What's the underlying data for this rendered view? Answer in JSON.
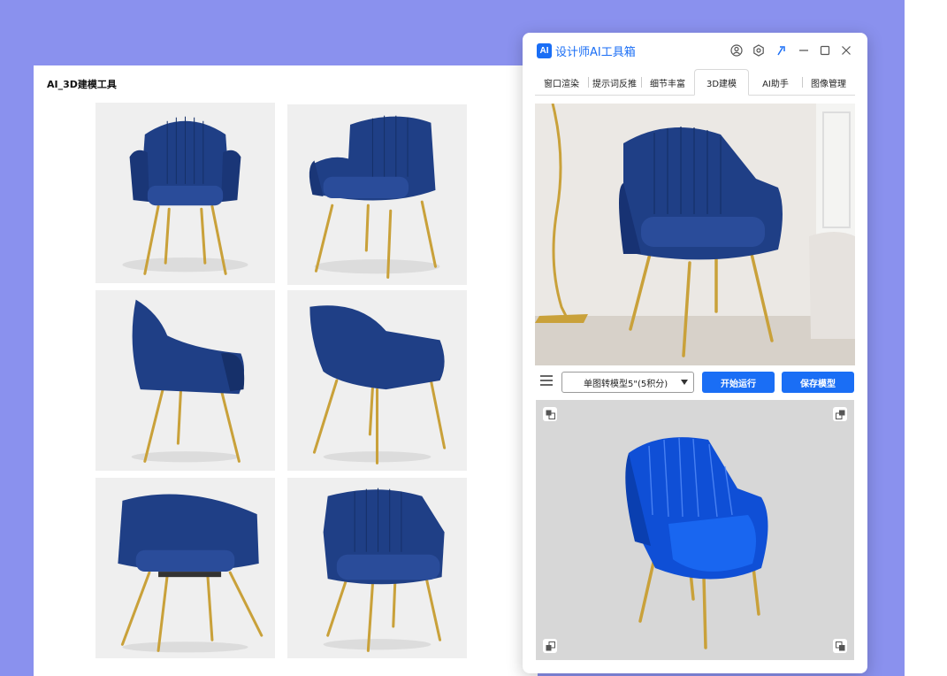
{
  "doc_window": {
    "title": "AI_3D建模工具"
  },
  "app": {
    "logo": "AI",
    "title": "设计师AI工具箱",
    "header_icons": [
      "user-icon",
      "settings-icon",
      "pin-icon",
      "minimize-icon",
      "maximize-icon",
      "close-icon"
    ],
    "tabs": [
      {
        "label": "窗口渲染",
        "active": false
      },
      {
        "label": "提示词反推",
        "active": false
      },
      {
        "label": "细节丰富",
        "active": false
      },
      {
        "label": "3D建模",
        "active": true
      },
      {
        "label": "AI助手",
        "active": false
      },
      {
        "label": "图像管理",
        "active": false
      }
    ],
    "controls": {
      "model_select": "单图转模型5\"(5积分)",
      "run_button": "开始运行",
      "save_button": "保存模型"
    }
  },
  "colors": {
    "background": "#8a91ee",
    "accent": "#1a6ef5",
    "chair_blue": "#1f3f86",
    "leg_gold": "#c9a13a"
  }
}
